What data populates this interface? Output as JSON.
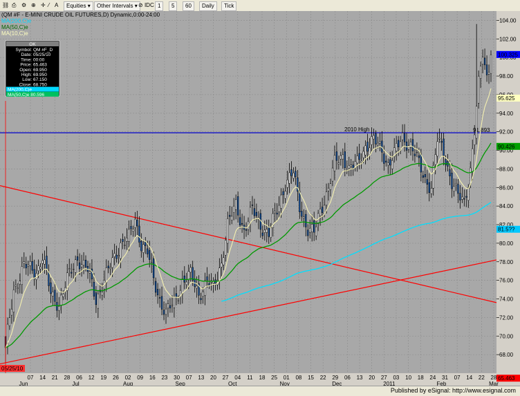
{
  "toolbar": {
    "items": [
      "Equities",
      "Other Intervals",
      "IDC",
      "1",
      "5",
      "60",
      "Daily",
      "Tick"
    ]
  },
  "footer": {
    "text": "Published by eSignal: http://www.esignal.com"
  },
  "chart_data": {
    "type": "candlestick",
    "title": "(QM #F - E-MINI CRUDE OIL FUTURES,D) Dynamic,0:00-24:00",
    "indicator_labels": [
      {
        "text": "MA(200,C)e",
        "color": "#00d8ff"
      },
      {
        "text": "MA(50,C)e",
        "color": "#00aa00"
      },
      {
        "text": "MA(10,C)e",
        "color": "#f0f0a0"
      }
    ],
    "ylim": [
      66,
      105
    ],
    "yticks": [
      68,
      70,
      72,
      74,
      76,
      78,
      80,
      82,
      84,
      86,
      88,
      90,
      92,
      94,
      96,
      98,
      100,
      102,
      104
    ],
    "x_labels": [
      "07",
      "14",
      "21",
      "28",
      "06",
      "12",
      "19",
      "26",
      "02",
      "09",
      "16",
      "23",
      "30",
      "07",
      "13",
      "20",
      "27",
      "04",
      "11",
      "18",
      "25",
      "01",
      "08",
      "15",
      "22",
      "29",
      "06",
      "13",
      "20",
      "27",
      "03",
      "10",
      "18",
      "24",
      "31",
      "07",
      "14",
      "22",
      "28"
    ],
    "month_labels": [
      "Jun",
      "Jul",
      "Aug",
      "Sep",
      "Oct",
      "Nov",
      "Dec",
      "2011",
      "Feb",
      "Mar"
    ],
    "first_date_label": "05/25/10",
    "data_box": {
      "header": "OK",
      "rows": [
        {
          "label": "Symbol",
          "value": "QM #F_D"
        },
        {
          "label": "Date",
          "value": "05/25/10"
        },
        {
          "label": "Time",
          "value": "00:00"
        },
        {
          "label": "Price",
          "value": "65.463"
        },
        {
          "label": "Open",
          "value": "69.950"
        },
        {
          "label": "High",
          "value": "69.950"
        },
        {
          "label": "Low",
          "value": "67.150"
        },
        {
          "label": "Close",
          "value": "68.750"
        }
      ],
      "ma_rows": [
        {
          "text": "MA(200,C)e",
          "color": "#00d8ff"
        },
        {
          "text": "MA(50,C)e 80.596",
          "color": "#00c060"
        }
      ]
    },
    "reference_line": {
      "value": 91.893,
      "label": "2010 High",
      "value_label": "91.893",
      "color": "#0000cc"
    },
    "price_labels": [
      {
        "value": 100.325,
        "text": "100.325",
        "bg": "#0000ff",
        "fg": "#ffffff"
      },
      {
        "value": 95.625,
        "text": "95.625",
        "bg": "#ffffc0",
        "fg": "#888800"
      },
      {
        "value": 90.426,
        "text": "90.426",
        "bg": "#00a000",
        "fg": "#ffffff"
      },
      {
        "value": 81.5,
        "text": "81.5??",
        "bg": "#00c8ff",
        "fg": "#ffffff"
      },
      {
        "value": 65.463,
        "text": "65.463",
        "bg": "#ff0000",
        "fg": "#ffffff"
      }
    ],
    "trendlines": [
      {
        "from": [
          0,
          86.2
        ],
        "to": [
          1,
          73.6
        ],
        "color": "#ff0000"
      },
      {
        "from": [
          0,
          67.0
        ],
        "to": [
          1,
          78.2
        ],
        "color": "#ff0000"
      }
    ],
    "close_anchors": [
      [
        0,
        68.75
      ],
      [
        4,
        75.0
      ],
      [
        9,
        77.5
      ],
      [
        15,
        77.0
      ],
      [
        18,
        78.5
      ],
      [
        22,
        74.5
      ],
      [
        26,
        73.5
      ],
      [
        30,
        76.0
      ],
      [
        35,
        78.5
      ],
      [
        40,
        77.0
      ],
      [
        44,
        74.0
      ],
      [
        48,
        76.0
      ],
      [
        52,
        78.0
      ],
      [
        56,
        80.0
      ],
      [
        60,
        80.5
      ],
      [
        63,
        82.5
      ],
      [
        66,
        80.0
      ],
      [
        69,
        79.0
      ],
      [
        72,
        76.0
      ],
      [
        75,
        74.0
      ],
      [
        78,
        72.5
      ],
      [
        82,
        73.5
      ],
      [
        86,
        76.0
      ],
      [
        90,
        76.5
      ],
      [
        94,
        74.5
      ],
      [
        98,
        76.0
      ],
      [
        101,
        75.0
      ],
      [
        105,
        78.0
      ],
      [
        108,
        82.0
      ],
      [
        112,
        84.0
      ],
      [
        116,
        81.5
      ],
      [
        120,
        83.5
      ],
      [
        124,
        82.0
      ],
      [
        128,
        81.0
      ],
      [
        132,
        83.5
      ],
      [
        136,
        86.5
      ],
      [
        140,
        87.5
      ],
      [
        143,
        84.0
      ],
      [
        147,
        81.5
      ],
      [
        150,
        81.0
      ],
      [
        153,
        83.5
      ],
      [
        157,
        86.0
      ],
      [
        160,
        88.5
      ],
      [
        164,
        89.5
      ],
      [
        167,
        88.0
      ],
      [
        171,
        88.5
      ],
      [
        175,
        90.5
      ],
      [
        179,
        91.0
      ],
      [
        183,
        90.0
      ],
      [
        186,
        88.5
      ],
      [
        189,
        89.5
      ],
      [
        193,
        91.5
      ],
      [
        197,
        90.5
      ],
      [
        200,
        89.0
      ],
      [
        204,
        87.0
      ],
      [
        207,
        86.0
      ],
      [
        210,
        91.0
      ],
      [
        213,
        90.0
      ],
      [
        217,
        86.5
      ],
      [
        220,
        85.0
      ],
      [
        223,
        84.5
      ],
      [
        226,
        88.0
      ],
      [
        228,
        92.0
      ],
      [
        230,
        97.0
      ],
      [
        232,
        100.5
      ],
      [
        234,
        98.0
      ],
      [
        236,
        100.3
      ]
    ]
  }
}
